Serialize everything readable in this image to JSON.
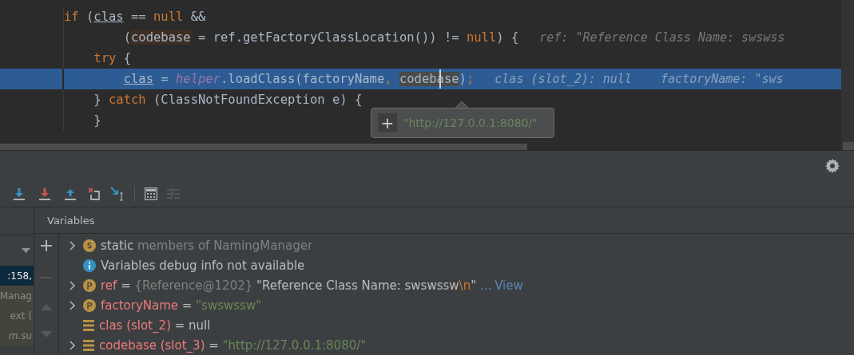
{
  "editor": {
    "lines": [
      {
        "kind": "statement",
        "highlighted": false,
        "tokens": [
          {
            "text": "if",
            "kind": "keyword"
          },
          {
            "text": " (",
            "kind": "plain"
          },
          {
            "text": "clas",
            "kind": "local"
          },
          {
            "text": " == ",
            "kind": "plain"
          },
          {
            "text": "null",
            "kind": "keyword"
          },
          {
            "text": " &&",
            "kind": "plain"
          }
        ],
        "children": [
          {
            "kind": "continuation",
            "highlighted": false,
            "tokens": [
              {
                "text": "(",
                "kind": "plain"
              },
              {
                "text": "codebase",
                "kind": "marked"
              },
              {
                "text": " = ref.getFactoryClassLocation()) != ",
                "kind": "plain"
              },
              {
                "text": "null",
                "kind": "keyword"
              },
              {
                "text": ") {",
                "kind": "plain"
              }
            ],
            "hint": "ref: \"Reference Class Name: swswss"
          },
          {
            "kind": "statement",
            "highlighted": false,
            "tokens": [
              {
                "text": "try",
                "kind": "keyword"
              },
              {
                "text": " {",
                "kind": "plain"
              }
            ],
            "children": [
              {
                "kind": "statement",
                "highlighted": true,
                "tokens": [
                  {
                    "text": "clas",
                    "kind": "local"
                  },
                  {
                    "text": " = ",
                    "kind": "plain"
                  },
                  {
                    "text": "helper",
                    "kind": "static"
                  },
                  {
                    "text": ".loadClass(factoryName",
                    "kind": "plain"
                  },
                  {
                    "text": ",",
                    "kind": "keyword"
                  },
                  {
                    "text": "codebase",
                    "kind": "cursor"
                  },
                  {
                    "text": ")",
                    "kind": "plain"
                  },
                  {
                    "text": ";",
                    "kind": "keyword"
                  }
                ],
                "hint": "clas (slot_2): null    factoryName: \"sws"
              }
            ]
          },
          {
            "kind": "statement",
            "highlighted": false,
            "tokens": [
              {
                "text": "} ",
                "kind": "plain"
              },
              {
                "text": "catch",
                "kind": "keyword"
              },
              {
                "text": " (ClassNotFoundException e) {",
                "kind": "plain"
              }
            ]
          },
          {
            "kind": "statement",
            "highlighted": false,
            "tokens": [
              {
                "text": "}",
                "kind": "plain"
              }
            ]
          }
        ]
      }
    ],
    "tooltip": {
      "button": "+",
      "value": "\"http://127.0.0.1:8080/\""
    }
  },
  "frames": [
    {
      "text": ":158,",
      "selected": true,
      "italic": false
    },
    {
      "text": "Manag",
      "selected": false,
      "italic": false
    },
    {
      "text": "ext (",
      "selected": false,
      "italic": false
    },
    {
      "text": "m.su",
      "selected": false,
      "italic": true
    }
  ],
  "variables": {
    "title": "Variables",
    "rows": [
      {
        "kind": "static",
        "expandable": true,
        "parts": [
          {
            "text": "static",
            "kind": "plain"
          },
          {
            "text": " members of NamingManager",
            "kind": "muted"
          }
        ]
      },
      {
        "kind": "info",
        "expandable": false,
        "parts": [
          {
            "text": "Variables debug info not available",
            "kind": "plain"
          }
        ]
      },
      {
        "kind": "param",
        "expandable": true,
        "parts": [
          {
            "text": "ref",
            "kind": "name"
          },
          {
            "text": " = ",
            "kind": "plain"
          },
          {
            "text": "{Reference@1202}",
            "kind": "muted"
          },
          {
            "text": " \"Reference Class Name: swswssw",
            "kind": "plain"
          },
          {
            "text": "\\n",
            "kind": "escape"
          },
          {
            "text": "\"",
            "kind": "plain"
          },
          {
            "text": " ...",
            "kind": "link"
          }
        ],
        "link": "View"
      },
      {
        "kind": "param",
        "expandable": true,
        "parts": [
          {
            "text": "factoryName",
            "kind": "name"
          },
          {
            "text": " = ",
            "kind": "plain"
          },
          {
            "text": "\"swswssw\"",
            "kind": "string"
          }
        ]
      },
      {
        "kind": "field",
        "expandable": false,
        "parts": [
          {
            "text": "clas (slot_2)",
            "kind": "name"
          },
          {
            "text": " = null",
            "kind": "plain"
          }
        ]
      },
      {
        "kind": "field",
        "expandable": true,
        "parts": [
          {
            "text": "codebase (slot_3)",
            "kind": "name"
          },
          {
            "text": " = ",
            "kind": "plain"
          },
          {
            "text": "\"http://127.0.0.1:8080/\"",
            "kind": "string"
          }
        ]
      }
    ]
  }
}
